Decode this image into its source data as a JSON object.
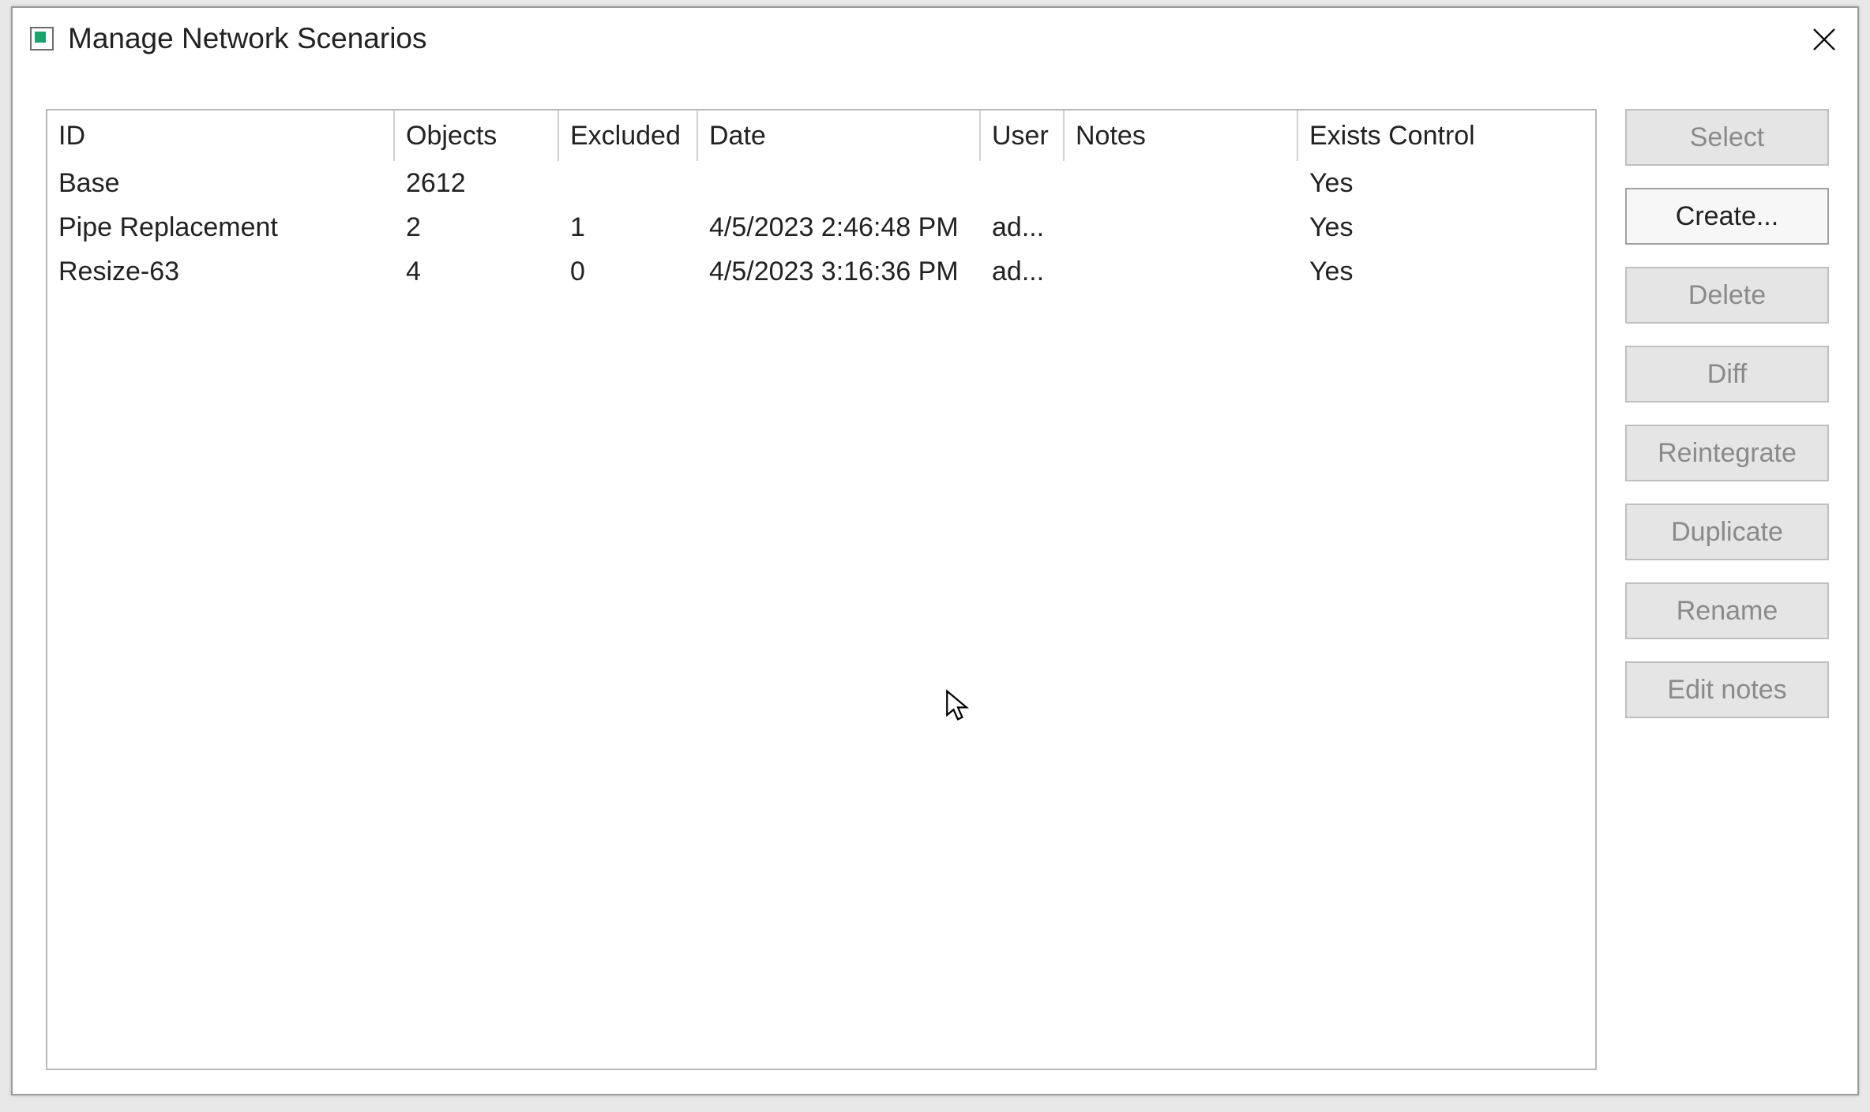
{
  "window": {
    "title": "Manage Network Scenarios"
  },
  "grid": {
    "headers": {
      "id": "ID",
      "objects": "Objects",
      "excluded": "Excluded",
      "date": "Date",
      "user": "User",
      "notes": "Notes",
      "exists": "Exists Control"
    },
    "rows": [
      {
        "id": "Base",
        "objects": "2612",
        "excluded": "",
        "date": "",
        "user": "",
        "notes": "",
        "exists": "Yes"
      },
      {
        "id": "Pipe Replacement",
        "objects": "2",
        "excluded": "1",
        "date": "4/5/2023 2:46:48 PM",
        "user": "ad...",
        "notes": "",
        "exists": "Yes"
      },
      {
        "id": "Resize-63",
        "objects": "4",
        "excluded": "0",
        "date": "4/5/2023 3:16:36 PM",
        "user": "ad...",
        "notes": "",
        "exists": "Yes"
      }
    ]
  },
  "buttons": {
    "select": "Select",
    "create": "Create...",
    "delete": "Delete",
    "diff": "Diff",
    "reintegrate": "Reintegrate",
    "duplicate": "Duplicate",
    "rename": "Rename",
    "edit_notes": "Edit notes"
  }
}
